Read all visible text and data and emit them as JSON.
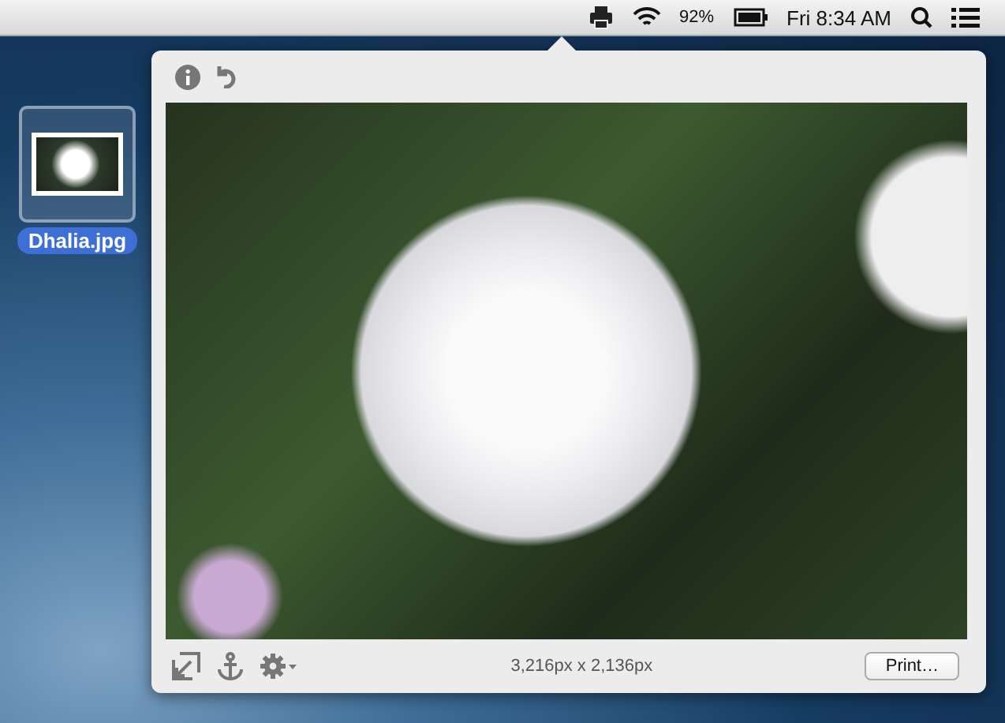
{
  "menu_bar": {
    "battery": "92%",
    "clock": "Fri 8:34 AM"
  },
  "desktop_icon": {
    "label": "Dhalia.jpg",
    "selected": true
  },
  "preview": {
    "dimensions": "3,216px x 2,136px",
    "print_button": "Print…"
  }
}
